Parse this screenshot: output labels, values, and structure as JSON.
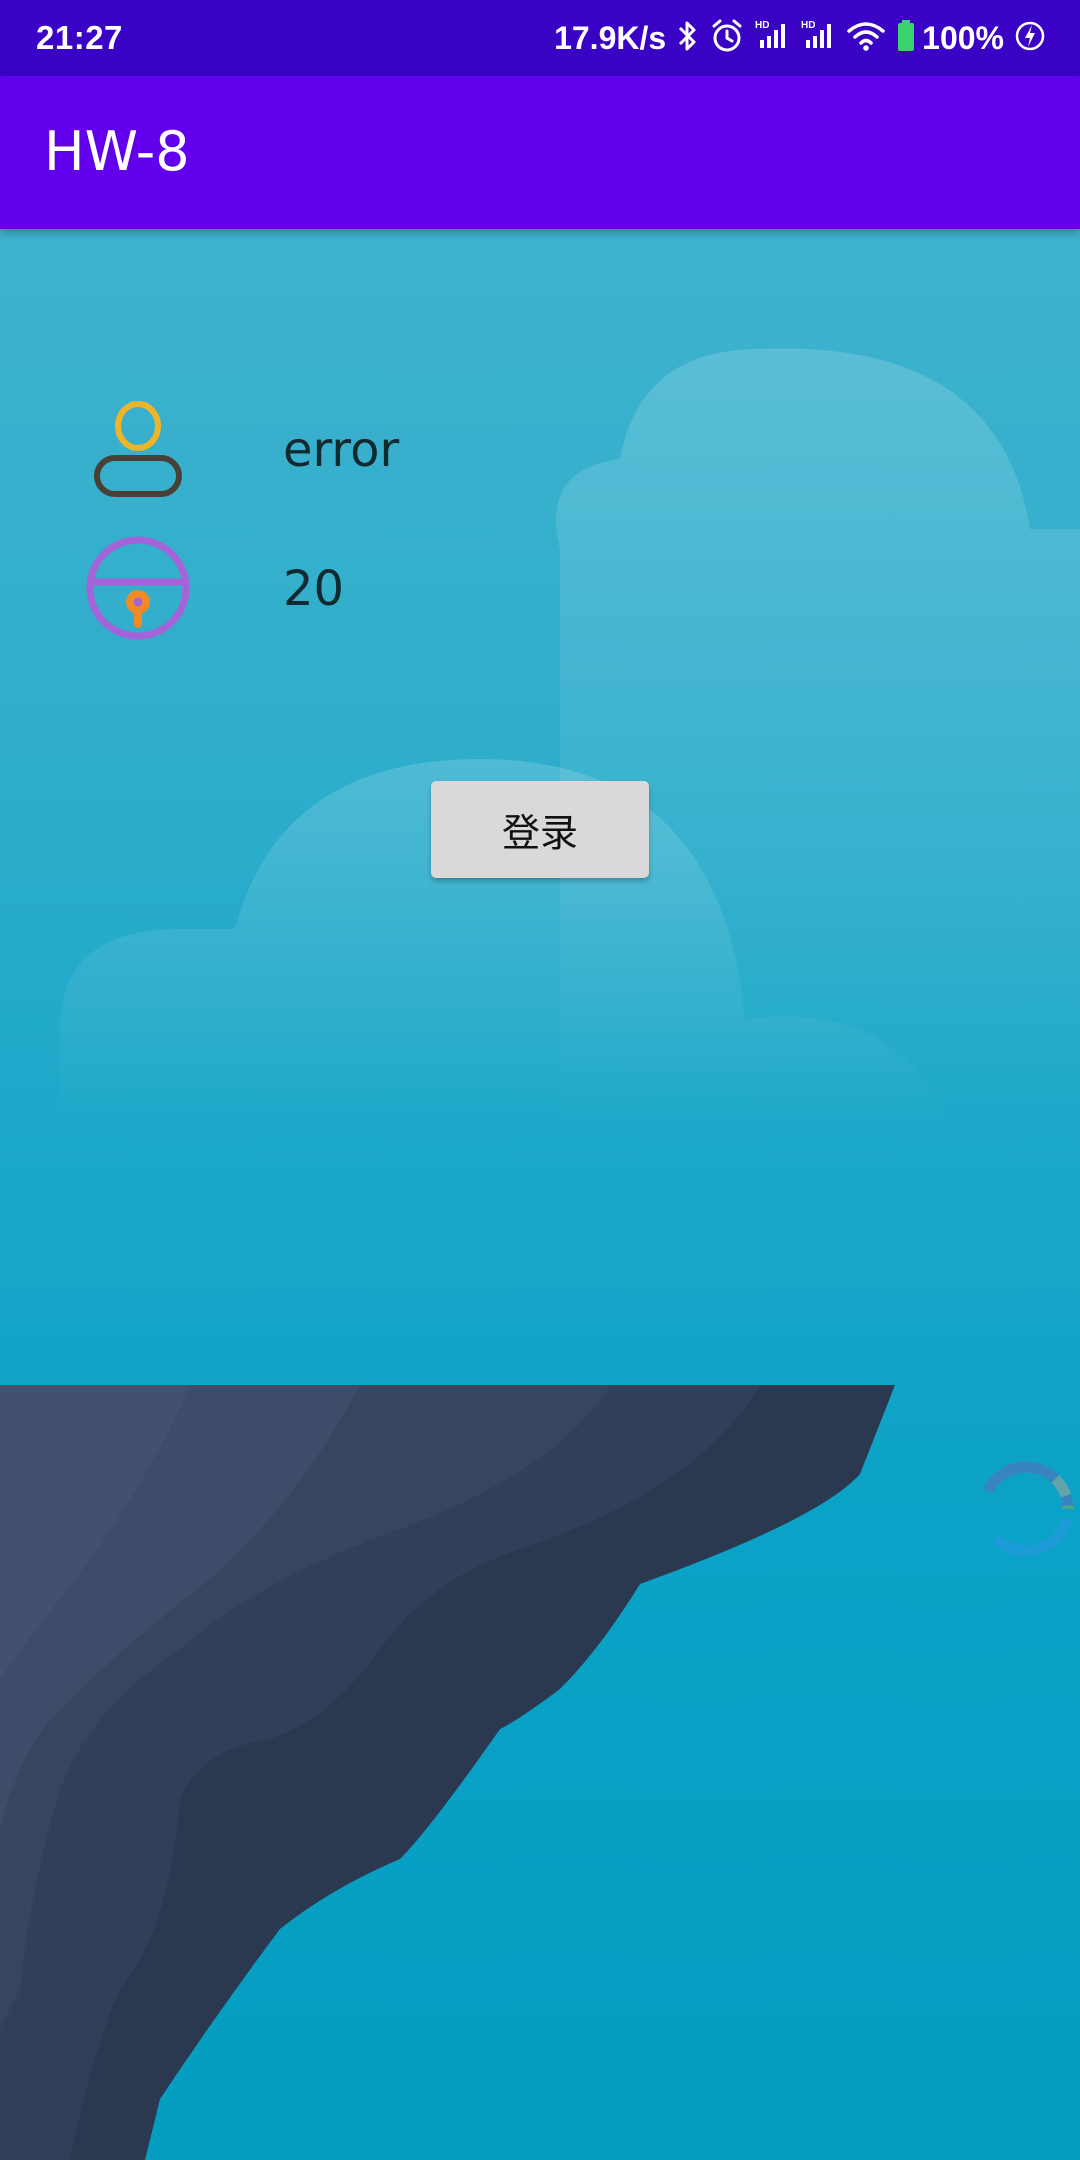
{
  "status_bar": {
    "time": "21:27",
    "net_speed": "17.9K/s",
    "battery": "100%",
    "icons": [
      "bluetooth-icon",
      "alarm-icon",
      "hd-signal-icon",
      "hd-signal-icon",
      "wifi-icon",
      "battery-icon",
      "charging-icon"
    ]
  },
  "app_bar": {
    "title": "HW-8"
  },
  "form": {
    "username_value": "error",
    "password_value": "20",
    "username_icon": "user-icon",
    "password_icon": "lock-icon"
  },
  "login_button": {
    "label": "登录"
  },
  "colors": {
    "status_bar": "#3a02c4",
    "app_bar": "#6200ee",
    "button": "#d9d9d9",
    "user_icon_head": "#f0b429",
    "user_icon_body": "#4a4036",
    "lock_icon": "#a463d8",
    "lock_keyhole": "#f08a24"
  }
}
